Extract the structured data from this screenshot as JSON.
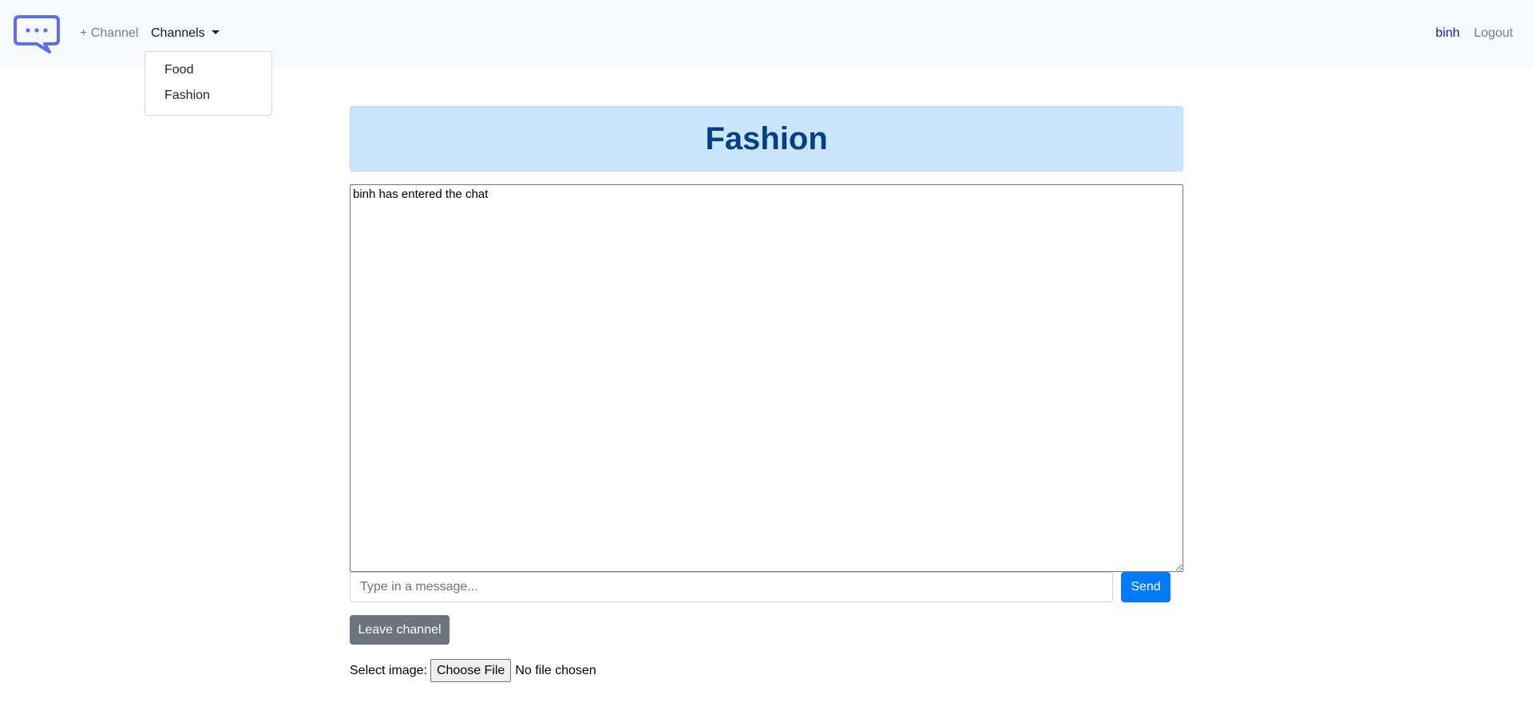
{
  "navbar": {
    "logo_icon": "chat-bubble-icon",
    "add_channel_label": "+ Channel",
    "channels_label": "Channels",
    "user_label": "binh",
    "logout_label": "Logout"
  },
  "dropdown": {
    "items": [
      {
        "label": "Food"
      },
      {
        "label": "Fashion"
      }
    ]
  },
  "channel": {
    "title": "Fashion"
  },
  "chat": {
    "log": "binh has entered the chat",
    "input_placeholder": "Type in a message...",
    "send_label": "Send"
  },
  "actions": {
    "leave_label": "Leave channel"
  },
  "upload": {
    "label": "Select image:",
    "button_label": "Choose File",
    "status": "No file chosen"
  },
  "colors": {
    "brand_icon": "#5b6ff5",
    "primary": "#007bff",
    "secondary": "#6c757d",
    "title_bg": "#cce5ff",
    "title_text": "#004085",
    "user_link": "#0d1bd6"
  }
}
